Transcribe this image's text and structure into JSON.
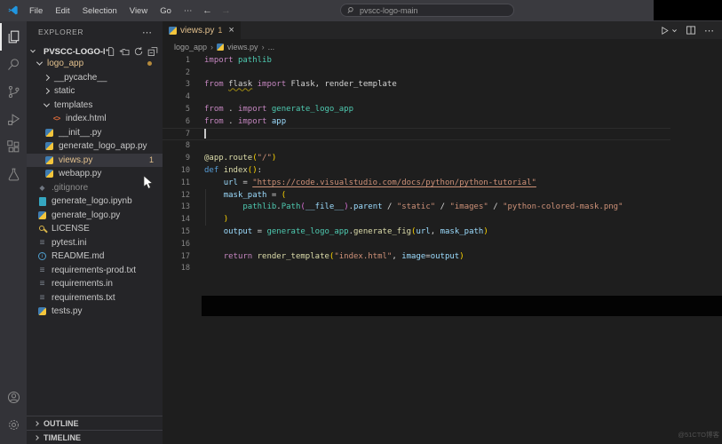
{
  "titlebar": {
    "menus": [
      "File",
      "Edit",
      "Selection",
      "View",
      "Go",
      "⋯"
    ],
    "back_arrow": "←",
    "forward_arrow": "→",
    "search_value": "pvscc-logo-main"
  },
  "activity_bar": {
    "top": [
      {
        "icon": "explorer",
        "active": true
      },
      {
        "icon": "search",
        "active": false
      },
      {
        "icon": "source-control",
        "active": false
      },
      {
        "icon": "run-debug",
        "active": false
      },
      {
        "icon": "extensions",
        "active": false
      },
      {
        "icon": "testing",
        "active": false
      }
    ],
    "bottom": [
      {
        "icon": "account",
        "active": false
      },
      {
        "icon": "settings",
        "active": false
      }
    ]
  },
  "sidebar": {
    "title": "EXPLORER",
    "more_label": "⋯",
    "section": {
      "label": "PVSCC-LOGO-M...",
      "actions": [
        "new-file",
        "new-folder",
        "refresh",
        "collapse-all"
      ]
    },
    "tree": [
      {
        "label": "logo_app",
        "type": "folder",
        "expanded": true,
        "depth": 1,
        "color": "mod",
        "badge": "dot"
      },
      {
        "label": "__pycache__",
        "type": "folder",
        "expanded": false,
        "depth": 2
      },
      {
        "label": "static",
        "type": "folder",
        "expanded": false,
        "depth": 2
      },
      {
        "label": "templates",
        "type": "folder",
        "expanded": true,
        "depth": 2
      },
      {
        "label": "index.html",
        "type": "html",
        "depth": 3
      },
      {
        "label": "__init__.py",
        "type": "python",
        "depth": 2
      },
      {
        "label": "generate_logo_app.py",
        "type": "python",
        "depth": 2
      },
      {
        "label": "views.py",
        "type": "python",
        "depth": 2,
        "selected": true,
        "color": "mod",
        "badge": "1"
      },
      {
        "label": "webapp.py",
        "type": "python",
        "depth": 2
      },
      {
        "label": ".gitignore",
        "type": "git",
        "depth": 1,
        "color": "dim"
      },
      {
        "label": "generate_logo.ipynb",
        "type": "notebook",
        "depth": 1
      },
      {
        "label": "generate_logo.py",
        "type": "python",
        "depth": 1
      },
      {
        "label": "LICENSE",
        "type": "license",
        "depth": 1
      },
      {
        "label": "pytest.ini",
        "type": "text",
        "depth": 1
      },
      {
        "label": "README.md",
        "type": "info",
        "depth": 1
      },
      {
        "label": "requirements-prod.txt",
        "type": "text",
        "depth": 1
      },
      {
        "label": "requirements.in",
        "type": "text",
        "depth": 1
      },
      {
        "label": "requirements.txt",
        "type": "text",
        "depth": 1
      },
      {
        "label": "tests.py",
        "type": "python",
        "depth": 1
      }
    ],
    "panels": [
      {
        "label": "OUTLINE"
      },
      {
        "label": "TIMELINE"
      }
    ]
  },
  "editor": {
    "tab": {
      "icon": "python",
      "label": "views.py",
      "badge": "1",
      "close": "×"
    },
    "actions": [
      {
        "icon": "run"
      },
      {
        "icon": "split-editor"
      },
      {
        "icon": "more-actions"
      }
    ],
    "breadcrumbs": [
      {
        "label": "logo_app"
      },
      {
        "label": "views.py",
        "icon": "python"
      },
      {
        "label": "..."
      }
    ],
    "code": {
      "language": "python",
      "lines": [
        {
          "n": 1,
          "tokens": [
            [
              "k",
              "import"
            ],
            [
              "w",
              " "
            ],
            [
              "t",
              "pathlib"
            ]
          ]
        },
        {
          "n": 2,
          "tokens": []
        },
        {
          "n": 3,
          "tokens": [
            [
              "k",
              "from"
            ],
            [
              "w",
              " "
            ],
            [
              "sq",
              "flask"
            ],
            [
              "w",
              " "
            ],
            [
              "k",
              "import"
            ],
            [
              "w",
              " Flask, render_template"
            ]
          ]
        },
        {
          "n": 4,
          "tokens": []
        },
        {
          "n": 5,
          "tokens": [
            [
              "k",
              "from"
            ],
            [
              "w",
              " . "
            ],
            [
              "k",
              "import"
            ],
            [
              "w",
              " "
            ],
            [
              "t",
              "generate_logo_app"
            ]
          ]
        },
        {
          "n": 6,
          "tokens": [
            [
              "k",
              "from"
            ],
            [
              "w",
              " . "
            ],
            [
              "k",
              "import"
            ],
            [
              "w",
              " "
            ],
            [
              "v",
              "app"
            ]
          ]
        },
        {
          "n": 7,
          "tokens": [],
          "cursor": true,
          "current": true
        },
        {
          "n": 8,
          "tokens": []
        },
        {
          "n": 9,
          "tokens": [
            [
              "f",
              "@app.route"
            ],
            [
              "g",
              "("
            ],
            [
              "s",
              "\"/\""
            ],
            [
              "g",
              ")"
            ]
          ]
        },
        {
          "n": 10,
          "tokens": [
            [
              "d",
              "def"
            ],
            [
              "w",
              " "
            ],
            [
              "f",
              "index"
            ],
            [
              "g",
              "()"
            ],
            [
              "w",
              ":"
            ]
          ]
        },
        {
          "n": 11,
          "tokens": [
            [
              "w",
              "    "
            ],
            [
              "v",
              "url"
            ],
            [
              "w",
              " = "
            ],
            [
              "su",
              "\"https://code.visualstudio.com/docs/python/python-tutorial\""
            ]
          ]
        },
        {
          "n": 12,
          "tokens": [
            [
              "w",
              "    "
            ],
            [
              "v",
              "mask_path"
            ],
            [
              "w",
              " = "
            ],
            [
              "g",
              "("
            ]
          ]
        },
        {
          "n": 13,
          "tokens": [
            [
              "w",
              "        "
            ],
            [
              "t",
              "pathlib"
            ],
            [
              "w",
              "."
            ],
            [
              "t",
              "Path"
            ],
            [
              "p",
              "("
            ],
            [
              "v",
              "__file__"
            ],
            [
              "p",
              ")"
            ],
            [
              "w",
              "."
            ],
            [
              "v",
              "parent"
            ],
            [
              "w",
              " / "
            ],
            [
              "s",
              "\"static\""
            ],
            [
              "w",
              " / "
            ],
            [
              "s",
              "\"images\""
            ],
            [
              "w",
              " / "
            ],
            [
              "s",
              "\"python-colored-mask.png\""
            ]
          ]
        },
        {
          "n": 14,
          "tokens": [
            [
              "w",
              "    "
            ],
            [
              "g",
              ")"
            ]
          ]
        },
        {
          "n": 15,
          "tokens": [
            [
              "w",
              "    "
            ],
            [
              "v",
              "output"
            ],
            [
              "w",
              " = "
            ],
            [
              "t",
              "generate_logo_app"
            ],
            [
              "w",
              "."
            ],
            [
              "f",
              "generate_fig"
            ],
            [
              "g",
              "("
            ],
            [
              "v",
              "url"
            ],
            [
              "w",
              ", "
            ],
            [
              "v",
              "mask_path"
            ],
            [
              "g",
              ")"
            ]
          ]
        },
        {
          "n": 16,
          "tokens": []
        },
        {
          "n": 17,
          "tokens": [
            [
              "w",
              "    "
            ],
            [
              "k",
              "return"
            ],
            [
              "w",
              " "
            ],
            [
              "f",
              "render_template"
            ],
            [
              "g",
              "("
            ],
            [
              "s",
              "\"index.html\""
            ],
            [
              "w",
              ", "
            ],
            [
              "v",
              "image"
            ],
            [
              "w",
              "="
            ],
            [
              "v",
              "output"
            ],
            [
              "g",
              ")"
            ]
          ]
        },
        {
          "n": 18,
          "tokens": []
        }
      ]
    }
  },
  "watermark": "@51CTO博客",
  "colors": {
    "modified": "#e2c08d",
    "accent": "#2096e0",
    "selection_bg": "#37373d"
  }
}
